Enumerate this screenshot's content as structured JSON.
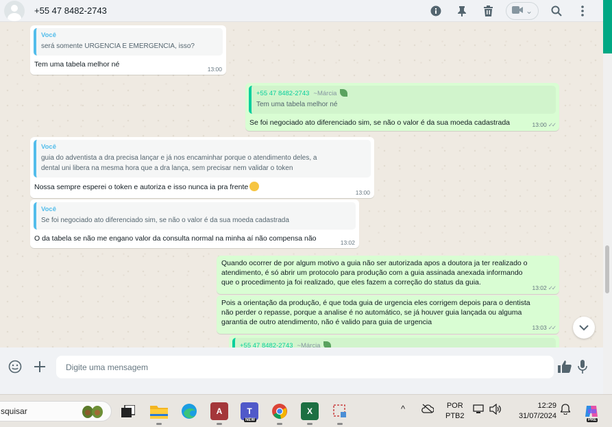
{
  "header": {
    "contact_name": "+55 47 8482-2743",
    "icons": [
      "info-icon",
      "pin-icon",
      "trash-icon",
      "video-call-icon",
      "search-icon",
      "more-options-icon"
    ]
  },
  "messages": [
    {
      "direction": "in",
      "quote_author": "Você",
      "quote_text": "será somente URGENCIA E EMERGENCIA, isso?",
      "text": "Tem uma tabela melhor né",
      "time": "13:00"
    },
    {
      "direction": "out",
      "quote_author": "+55 47 8482-2743",
      "quote_alias": "~Márcia",
      "quote_text": "Tem uma tabela melhor né",
      "text": "Se foi negociado ato diferenciado sim, se não o valor é da sua moeda cadastrada",
      "time": "13:00"
    },
    {
      "direction": "in",
      "quote_author": "Você",
      "quote_text_line1": "guia do adventista a dra precisa lançar e já nos encaminhar porque o atendimento deles, a",
      "quote_text_line2": "dental uni libera na mesma hora que a dra lança, sem precisar nem validar o token",
      "text": "Nossa sempre esperei o token e autoriza e isso nunca ia pra frente",
      "time": "13:00"
    },
    {
      "direction": "in",
      "quote_author": "Você",
      "quote_text": "Se foi negociado ato diferenciado sim, se não o valor é da sua moeda cadastrada",
      "text": "O da tabela se não me engano valor da consulta normal na minha aí não compensa não",
      "time": "13:02"
    },
    {
      "direction": "out",
      "text_line1": "Quando ocorrer de por algum motivo a guia não ser autorizada apos a doutora ja ter realizado o",
      "text_line2": "atendimento, é só abrir um protocolo para produção com a guia assinada anexada informando",
      "text_line3": "que o procedimento ja foi realizado, que eles fazem a correção do status da guia.",
      "time": "13:02"
    },
    {
      "direction": "out",
      "text_line1": "Pois a orientação da produção, é que toda guia de urgencia eles corrigem depois para o dentista",
      "text_line2": "não perder o repasse, porque a analise é no automático, se já houver guia lançada ou alguma",
      "text_line3": "garantia de outro atendimento, não é valido para guia de urgencia",
      "time": "13:03"
    },
    {
      "direction": "out",
      "quote_author": "+55 47 8482-2743",
      "quote_alias": "~Márcia"
    }
  ],
  "composer": {
    "placeholder": "Digite uma mensagem"
  },
  "taskbar": {
    "search_text": "squisar",
    "apps": [
      "task-view",
      "file-explorer",
      "edge",
      "access",
      "teams",
      "chrome",
      "excel",
      "snipping-tool"
    ],
    "teams_badge": "NEW",
    "language_line1": "POR",
    "language_line2": "PTB2",
    "time": "12:29",
    "date": "31/07/2024",
    "copilot_badge": "PRE"
  },
  "colors": {
    "outgoing_bubble": "#d9fdd3",
    "incoming_bubble": "#ffffff",
    "accent": "#00a884",
    "quote_bar_in": "#53bdeb",
    "quote_bar_out": "#06cf9c"
  }
}
